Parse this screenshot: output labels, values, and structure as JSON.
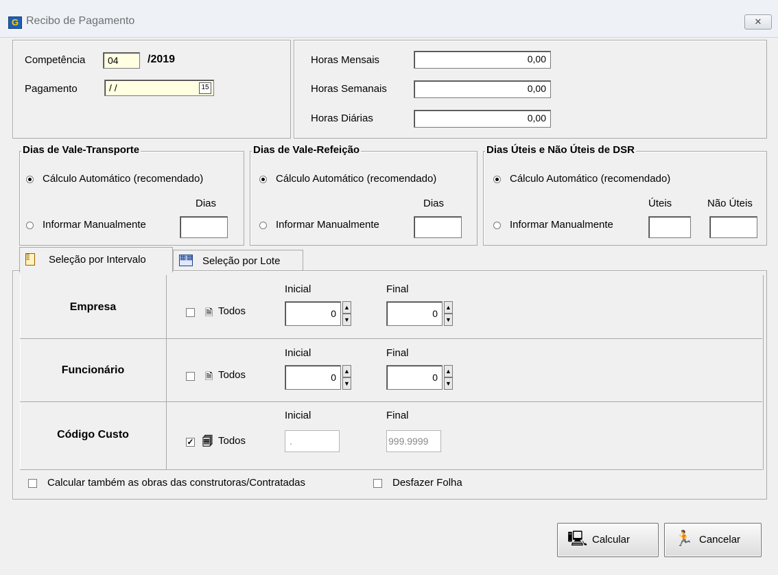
{
  "window": {
    "title": "Recibo de Pagamento",
    "app_icon": "G",
    "close_glyph": "✕"
  },
  "competencia": {
    "label": "Competência",
    "month": "04",
    "year": "/2019"
  },
  "pagamento": {
    "label": "Pagamento",
    "value": "/ /",
    "calendar_glyph": "15"
  },
  "horas": {
    "mensais": {
      "label": "Horas Mensais",
      "value": "0,00"
    },
    "semanais": {
      "label": "Horas Semanais",
      "value": "0,00"
    },
    "diarias": {
      "label": "Horas Diárias",
      "value": "0,00"
    }
  },
  "vale_transporte": {
    "title": "Dias de Vale-Transporte",
    "auto": "Cálculo Automático (recomendado)",
    "manual": "Informar Manualmente",
    "dias_label": "Dias",
    "dias_value": ""
  },
  "vale_refeicao": {
    "title": "Dias de Vale-Refeição",
    "auto": "Cálculo Automático (recomendado)",
    "manual": "Informar Manualmente",
    "dias_label": "Dias",
    "dias_value": ""
  },
  "dsr": {
    "title": "Dias Úteis e Não Úteis de DSR",
    "auto": "Cálculo Automático (recomendado)",
    "manual": "Informar Manualmente",
    "uteis_label": "Úteis",
    "nao_uteis_label": "Não Úteis"
  },
  "tabs": [
    {
      "label": "Seleção por Intervalo",
      "active": true
    },
    {
      "label": "Seleção por Lote",
      "active": false
    }
  ],
  "rows": [
    {
      "label": "Empresa",
      "todos": "Todos",
      "checked": false,
      "inicial_label": "Inicial",
      "inicial": "0",
      "final_label": "Final",
      "final": "0"
    },
    {
      "label": "Funcionário",
      "todos": "Todos",
      "checked": false,
      "inicial_label": "Inicial",
      "inicial": "0",
      "final_label": "Final",
      "final": "0"
    },
    {
      "label": "Código Custo",
      "todos": "Todos",
      "checked": true,
      "inicial_label": "Inicial",
      "inicial": ".",
      "final_label": "Final",
      "final": "999.9999"
    }
  ],
  "options": {
    "obras": "Calcular também as obras das construtoras/Contratadas",
    "desfazer": "Desfazer Folha"
  },
  "buttons": {
    "calcular": "Calcular",
    "cancelar": "Cancelar"
  },
  "colors": {
    "pagamento_bg": "#ffffe1",
    "cancel_icon": "#1aa21a"
  }
}
